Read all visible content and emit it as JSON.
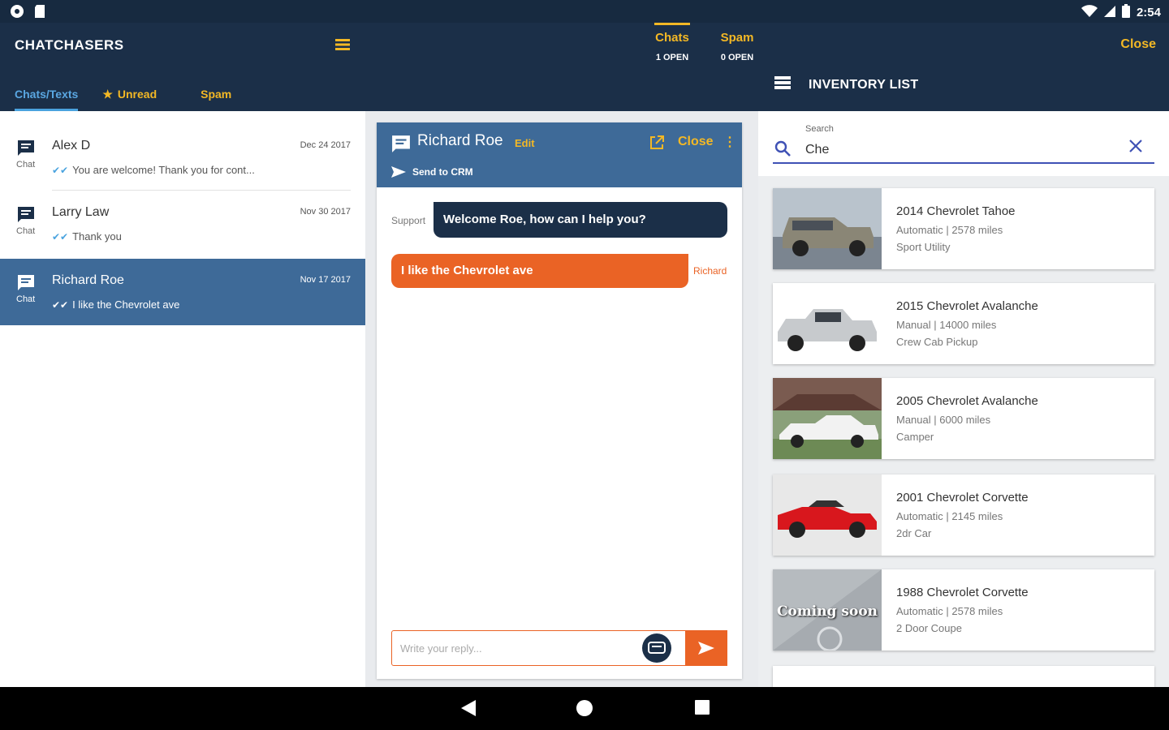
{
  "status_bar": {
    "time": "2:54"
  },
  "app": {
    "title": "CHATCHASERS",
    "tabs": [
      {
        "label": "Chats/Texts"
      },
      {
        "label": "Unread"
      },
      {
        "label": "Spam"
      }
    ],
    "counters": [
      {
        "label": "Chats",
        "sub": "1 OPEN"
      },
      {
        "label": "Spam",
        "sub": "0 OPEN"
      }
    ],
    "close_label": "Close",
    "inventory_title": "INVENTORY LIST"
  },
  "chat_list": [
    {
      "name": "Alex D",
      "type": "Chat",
      "date": "Dec 24 2017",
      "message": "You are welcome! Thank you for cont..."
    },
    {
      "name": "Larry Law",
      "type": "Chat",
      "date": "Nov 30 2017",
      "message": "Thank you"
    },
    {
      "name": "Richard Roe",
      "type": "Chat",
      "date": "Nov 17 2017",
      "message": "I like the Chevrolet ave"
    }
  ],
  "conversation": {
    "name": "Richard Roe",
    "edit_label": "Edit",
    "close_label": "Close",
    "more_label": "⋮",
    "send_to_crm": "Send to CRM",
    "messages": [
      {
        "sender": "Support",
        "text": "Welcome Roe, how can I help you?"
      },
      {
        "sender": "Richard",
        "text": "I like the Chevrolet ave"
      }
    ],
    "reply_placeholder": "Write your reply..."
  },
  "inventory": {
    "search_label": "Search",
    "search_value": "Che",
    "items": [
      {
        "title": "2014 Chevrolet Tahoe",
        "spec": "Automatic | 2578 miles",
        "type": "Sport Utility"
      },
      {
        "title": "2015 Chevrolet Avalanche",
        "spec": "Manual | 14000 miles",
        "type": "Crew Cab Pickup"
      },
      {
        "title": "2005 Chevrolet Avalanche",
        "spec": "Manual | 6000 miles",
        "type": "Camper"
      },
      {
        "title": "2001 Chevrolet Corvette",
        "spec": "Automatic | 2145 miles",
        "type": "2dr Car"
      },
      {
        "title": "1988 Chevrolet Corvette",
        "spec": "Automatic | 2578 miles",
        "type": "2 Door Coupe",
        "thumb_text": "Coming soon"
      }
    ]
  },
  "colors": {
    "navy": "#1b2f48",
    "blue": "#3e6a98",
    "accent_yellow": "#f3b825",
    "accent_orange": "#ea6325"
  }
}
